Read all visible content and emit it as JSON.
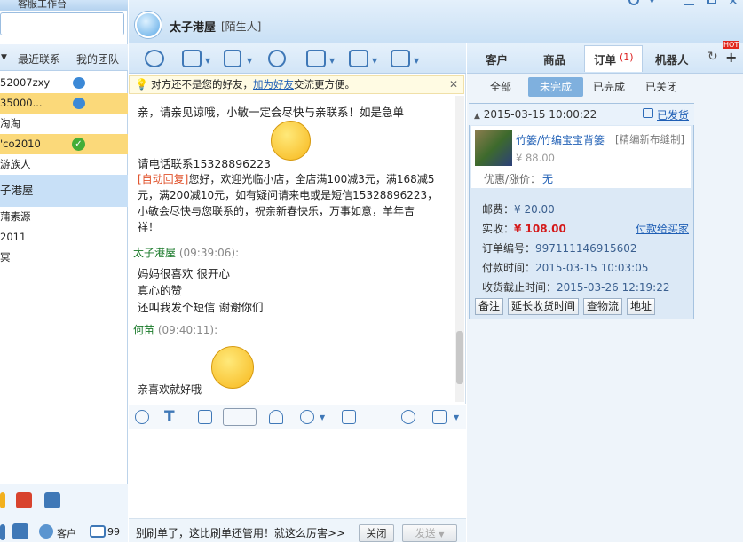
{
  "app": {
    "title": "客服工作台"
  },
  "left": {
    "tabs": [
      "最近联系",
      "我的团队"
    ],
    "contacts": [
      {
        "name": "52007zxy",
        "state": "normal",
        "icon": "mail"
      },
      {
        "name": "35000...",
        "state": "highlight",
        "icon": "mail"
      },
      {
        "name": "淘淘",
        "state": "normal",
        "icon": ""
      },
      {
        "name": "'co2010",
        "state": "highlight",
        "icon": "ok"
      },
      {
        "name": "游族人",
        "state": "normal",
        "icon": ""
      },
      {
        "name": "子港屋",
        "state": "current",
        "icon": ""
      },
      {
        "name": "蒲素源",
        "state": "normal",
        "icon": ""
      },
      {
        "name": "2011",
        "state": "normal",
        "icon": ""
      },
      {
        "name": "冥",
        "state": "normal",
        "icon": ""
      }
    ],
    "bottom": {
      "customer_label": "客户",
      "mail_count": "99"
    }
  },
  "header": {
    "name": "太子港屋",
    "tag": "[陌生人]"
  },
  "notice": {
    "pre": "对方还不是您的好友，",
    "link": "加为好友",
    "post": "交流更方便。"
  },
  "chat": {
    "partial_lines": [
      "亲，请亲见谅哦，小敏一定会尽快与亲联系！如是急单",
      "请电话联系15328896223"
    ],
    "auto_reply": {
      "tag": "[自动回复]",
      "lines": [
        "您好，欢迎光临小店，全店满100减3元，满168减5",
        "元，满200减10元，如有疑问请来电或是短信15328896223，",
        "小敏会尽快与您联系的，祝亲新春快乐，万事如意，羊年吉",
        "祥！"
      ]
    },
    "messages": [
      {
        "sender": "太子港屋",
        "time": "(09:39:06):",
        "lines": [
          "妈妈很喜欢   很开心",
          "真心的赞",
          "还叫我发个短信 谢谢你们"
        ]
      },
      {
        "sender": "何苗",
        "time": "(09:40:11):",
        "lines": [
          "亲喜欢就好哦"
        ]
      }
    ]
  },
  "footer": {
    "tip": "别刷单了，这比刷单还管用！就这么厉害>>",
    "close": "关闭",
    "send": "发送"
  },
  "right": {
    "tabs": [
      "客户",
      "商品",
      "订单",
      "机器人"
    ],
    "order_count": "(1)",
    "hot": "HOT",
    "subtabs": [
      "全部",
      "未完成",
      "已完成",
      "已关闭"
    ],
    "order": {
      "datetime": "2015-03-15 10:00:22",
      "status": "已发货",
      "product_title": "竹篓/竹编宝宝背篓",
      "product_variant": "[精编新布缝制]",
      "price": "¥ 88.00",
      "discount_label": "优惠/涨价：",
      "discount_value": "无",
      "shipping_label": "邮费：",
      "shipping_value": "¥ 20.00",
      "paid_label": "实收：",
      "paid_value": "¥ 108.00",
      "pay_link": "付款给买家",
      "no_label": "订单编号：",
      "no_value": "997111146915602",
      "paytime_label": "付款时间：",
      "paytime_value": "2015-03-15 10:03:05",
      "deadline_label": "收货截止时间：",
      "deadline_value": "2015-03-26 12:19:22",
      "buttons": [
        "备注",
        "延长收货时间",
        "查物流",
        "地址"
      ]
    }
  }
}
